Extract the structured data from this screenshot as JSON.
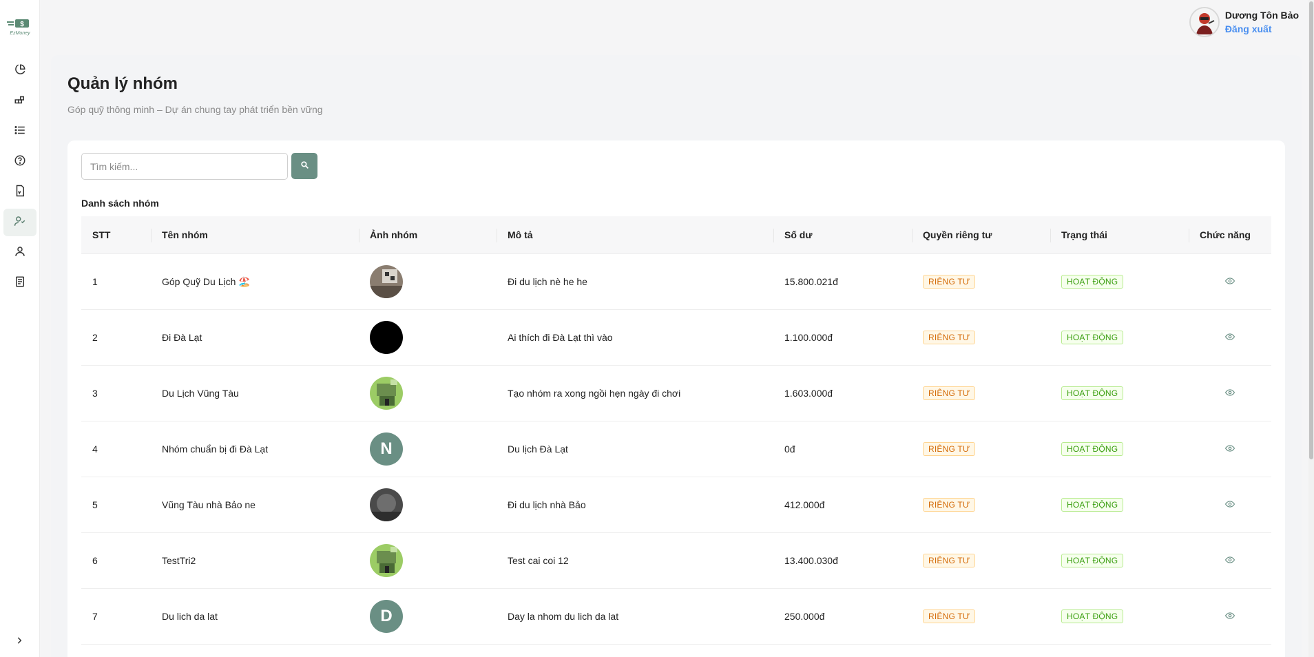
{
  "app": {
    "logo_text": "EzMoney"
  },
  "sidebar": {
    "items": [
      {
        "icon": "pie-chart-icon",
        "active": false
      },
      {
        "icon": "blocks-icon",
        "active": false
      },
      {
        "icon": "list-icon",
        "active": false
      },
      {
        "icon": "help-circle-icon",
        "active": false
      },
      {
        "icon": "document-icon",
        "active": false
      },
      {
        "icon": "users-icon",
        "active": true
      },
      {
        "icon": "user-icon",
        "active": false
      },
      {
        "icon": "receipt-icon",
        "active": false
      }
    ],
    "collapse_icon": "chevron-right-icon"
  },
  "header": {
    "user_name": "Dương Tôn Bảo",
    "logout_label": "Đăng xuất"
  },
  "page": {
    "title": "Quản lý nhóm",
    "subtitle": "Góp quỹ thông minh – Dự án chung tay phát triển bền vững"
  },
  "search": {
    "placeholder": "Tìm kiếm...",
    "value": ""
  },
  "list_title": "Danh sách nhóm",
  "table": {
    "columns": [
      "STT",
      "Tên nhóm",
      "Ảnh nhóm",
      "Mô tả",
      "Số dư",
      "Quyền riêng tư",
      "Trạng thái",
      "Chức năng"
    ],
    "rows": [
      {
        "stt": "1",
        "name": "Góp Quỹ Du Lịch 🏖️",
        "image": "photo-room",
        "description": "Đi du lịch nè he he",
        "balance": "15.800.021đ",
        "privacy": "RIÊNG TƯ",
        "status": "HOẠT ĐỘNG"
      },
      {
        "stt": "2",
        "name": "Đi Đà Lạt",
        "image": "photo-black",
        "description": "Ai thích đi Đà Lạt thì vào",
        "balance": "1.100.000đ",
        "privacy": "RIÊNG TƯ",
        "status": "HOẠT ĐỘNG"
      },
      {
        "stt": "3",
        "name": "Du Lịch Vũng Tàu",
        "image": "photo-green-house",
        "description": "Tạo nhóm ra xong ngồi hẹn ngày đi chơi",
        "balance": "1.603.000đ",
        "privacy": "RIÊNG TƯ",
        "status": "HOẠT ĐỘNG"
      },
      {
        "stt": "4",
        "name": "Nhóm chuẩn bị đi Đà Lạt",
        "image": "letter",
        "letter": "N",
        "description": "Du lịch Đà Lạt",
        "balance": "0đ",
        "privacy": "RIÊNG TƯ",
        "status": "HOẠT ĐỘNG"
      },
      {
        "stt": "5",
        "name": "Vũng Tàu nhà Bảo ne",
        "image": "photo-dark-room",
        "description": "Đi du lịch nhà Bảo",
        "balance": "412.000đ",
        "privacy": "RIÊNG TƯ",
        "status": "HOẠT ĐỘNG"
      },
      {
        "stt": "6",
        "name": "TestTri2",
        "image": "photo-green-house",
        "description": "Test cai coi 12",
        "balance": "13.400.030đ",
        "privacy": "RIÊNG TƯ",
        "status": "HOẠT ĐỘNG"
      },
      {
        "stt": "7",
        "name": "Du lich da lat",
        "image": "letter",
        "letter": "D",
        "description": "Day la nhom du lich da lat",
        "balance": "250.000đ",
        "privacy": "RIÊNG TƯ",
        "status": "HOẠT ĐỘNG"
      }
    ],
    "action_icon": "eye-icon"
  },
  "colors": {
    "accent": "#6a8f84",
    "link": "#4a8ff0",
    "private_tag": "#d46b08",
    "active_tag": "#389e0d"
  }
}
